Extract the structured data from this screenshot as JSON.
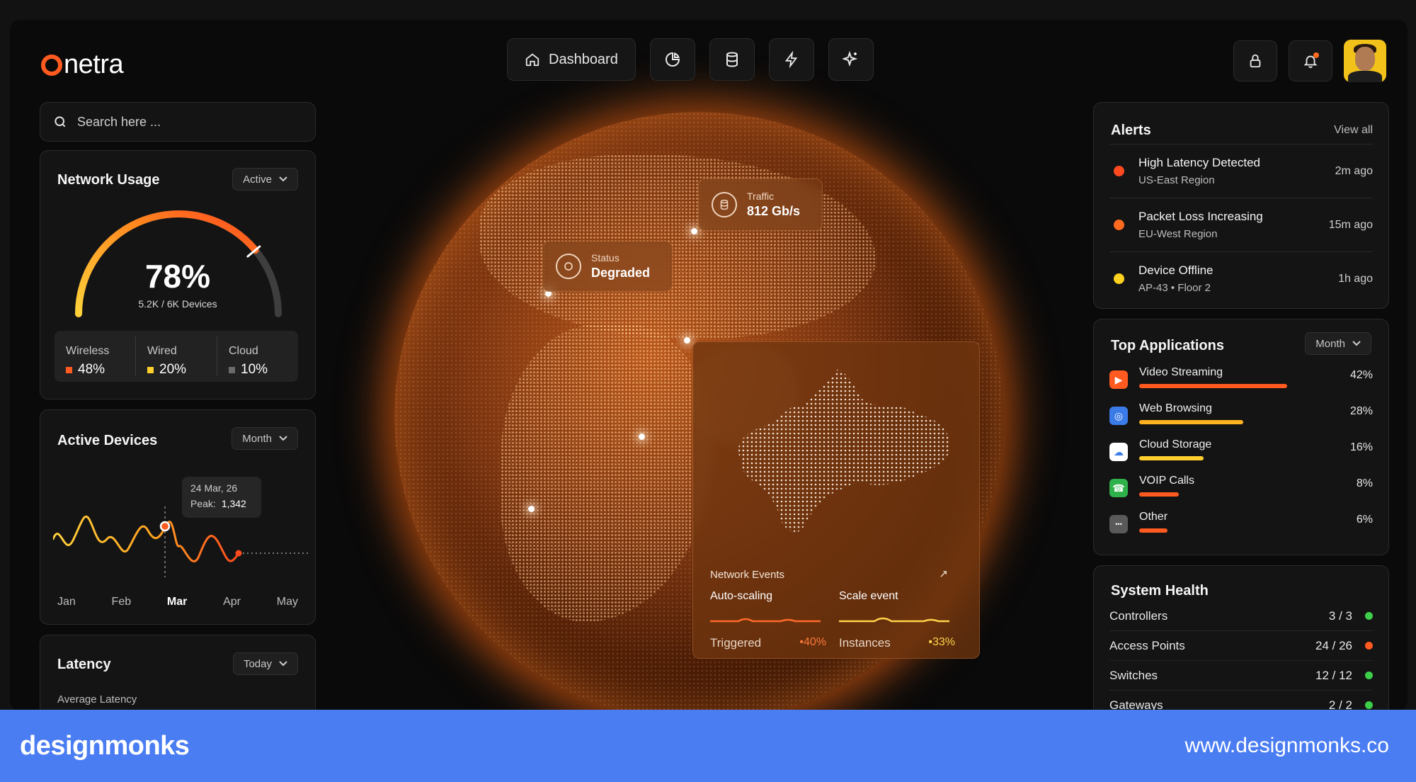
{
  "app": {
    "logo_text": "netra"
  },
  "nav": {
    "dashboard_label": "Dashboard",
    "icons": [
      "analytics-icon",
      "database-icon",
      "flash-icon",
      "sparkle-icon"
    ]
  },
  "search": {
    "placeholder": "Search here ..."
  },
  "network_usage": {
    "title": "Network Usage",
    "filter": "Active",
    "percent_text": "78%",
    "percent_value": 78,
    "devices_text": "5.2K / 6K Devices",
    "breakdown": [
      {
        "label": "Wireless",
        "value": "48%",
        "color": "#ff5a1f"
      },
      {
        "label": "Wired",
        "value": "20%",
        "color": "#ffcf2e"
      },
      {
        "label": "Cloud",
        "value": "10%",
        "color": "#6b6b6b"
      }
    ]
  },
  "active_devices": {
    "title": "Active Devices",
    "filter": "Month",
    "tooltip_date": "24 Mar, 26",
    "tooltip_peak_label": "Peak:",
    "tooltip_peak_value": "1,342",
    "months": [
      "Jan",
      "Feb",
      "Mar",
      "Apr",
      "May"
    ],
    "active_month": "Mar"
  },
  "latency": {
    "title": "Latency",
    "filter": "Today",
    "subtitle": "Average Latency"
  },
  "globe": {
    "status_label": "Status",
    "status_value": "Degraded",
    "traffic_label": "Traffic",
    "traffic_value": "812 Gb/s",
    "events_title": "Network Events",
    "events": [
      {
        "title": "Auto-scaling",
        "foot_label": "Triggered",
        "foot_value": "•40%",
        "color": "#ff6a2a"
      },
      {
        "title": "Scale event",
        "foot_label": "Instances",
        "foot_value": "•33%",
        "color": "#ffd24a"
      }
    ]
  },
  "alerts": {
    "title": "Alerts",
    "view_all": "View all",
    "items": [
      {
        "title": "High Latency Detected",
        "sub": "US-East Region",
        "time": "2m ago",
        "color": "#ff4a1f"
      },
      {
        "title": "Packet Loss Increasing",
        "sub": "EU-West Region",
        "time": "15m ago",
        "color": "#ff6a1f"
      },
      {
        "title": "Device Offline",
        "sub": "AP-43 • Floor 2",
        "time": "1h ago",
        "color": "#ffd21f"
      }
    ]
  },
  "top_apps": {
    "title": "Top Applications",
    "filter": "Month",
    "items": [
      {
        "name": "Video Streaming",
        "pct": "42%",
        "fraction": 0.78,
        "bar_color": "#ff5a1f",
        "icon": "video-icon",
        "icon_bg": "#ff5a1f"
      },
      {
        "name": "Web Browsing",
        "pct": "28%",
        "fraction": 0.55,
        "bar_color": "#ffb21f",
        "icon": "browser-icon",
        "icon_bg": "#3b7be8"
      },
      {
        "name": "Cloud Storage",
        "pct": "16%",
        "fraction": 0.34,
        "bar_color": "#ffcf2e",
        "icon": "cloud-icon",
        "icon_bg": "#ffffff"
      },
      {
        "name": "VOIP Calls",
        "pct": "8%",
        "fraction": 0.21,
        "bar_color": "#ff5a1f",
        "icon": "phone-icon",
        "icon_bg": "#2fb24c"
      },
      {
        "name": "Other",
        "pct": "6%",
        "fraction": 0.15,
        "bar_color": "#ff5a1f",
        "icon": "more-icon",
        "icon_bg": "#5a5a5a"
      }
    ]
  },
  "system_health": {
    "title": "System Health",
    "items": [
      {
        "name": "Controllers",
        "count": "3 / 3",
        "color": "#3ecf4a"
      },
      {
        "name": "Access Points",
        "count": "24 / 26",
        "color": "#ff5a1f"
      },
      {
        "name": "Switches",
        "count": "12 / 12",
        "color": "#3ecf4a"
      },
      {
        "name": "Gateways",
        "count": "2 / 2",
        "color": "#3ecf4a"
      }
    ]
  },
  "banner": {
    "brand": "designmonks",
    "url": "www.designmonks.co",
    "bg": "#4a7cf2"
  }
}
